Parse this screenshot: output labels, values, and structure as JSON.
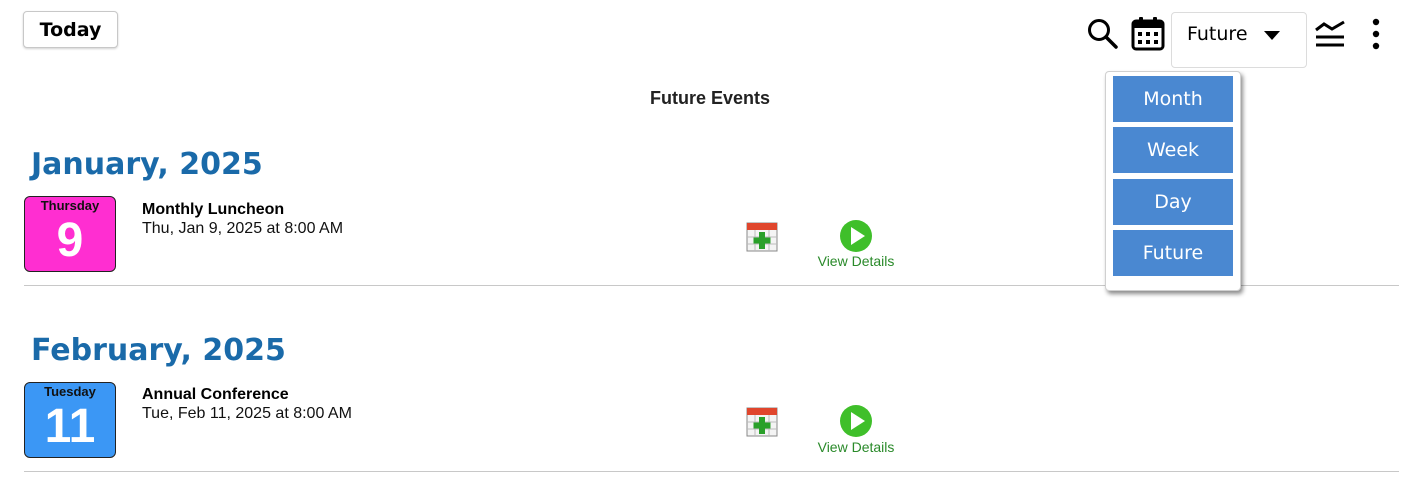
{
  "toolbar": {
    "today_label": "Today",
    "view_selected": "Future",
    "icons": [
      "search-icon",
      "calendar-icon",
      "chevron-down-icon",
      "filter-icon",
      "more-vertical-icon"
    ]
  },
  "view_menu": {
    "options": [
      "Month",
      "Week",
      "Day",
      "Future"
    ]
  },
  "page_title": "Future Events",
  "months": [
    {
      "heading": "January, 2025",
      "events": [
        {
          "weekday": "Thursday",
          "day": "9",
          "badge_color": "#ff2ed1",
          "title": "Monthly Luncheon",
          "datetime": "Thu, Jan 9, 2025 at 8:00 AM",
          "details_label": "View Details"
        }
      ]
    },
    {
      "heading": "February, 2025",
      "events": [
        {
          "weekday": "Tuesday",
          "day": "11",
          "badge_color": "#3b97f5",
          "title": "Annual Conference",
          "datetime": "Tue, Feb 11, 2025 at 8:00 AM",
          "details_label": "View Details"
        }
      ]
    }
  ],
  "colors": {
    "heading": "#1a6aa9",
    "menu_item": "#4a88d1",
    "details_link": "#2a8a2a"
  }
}
